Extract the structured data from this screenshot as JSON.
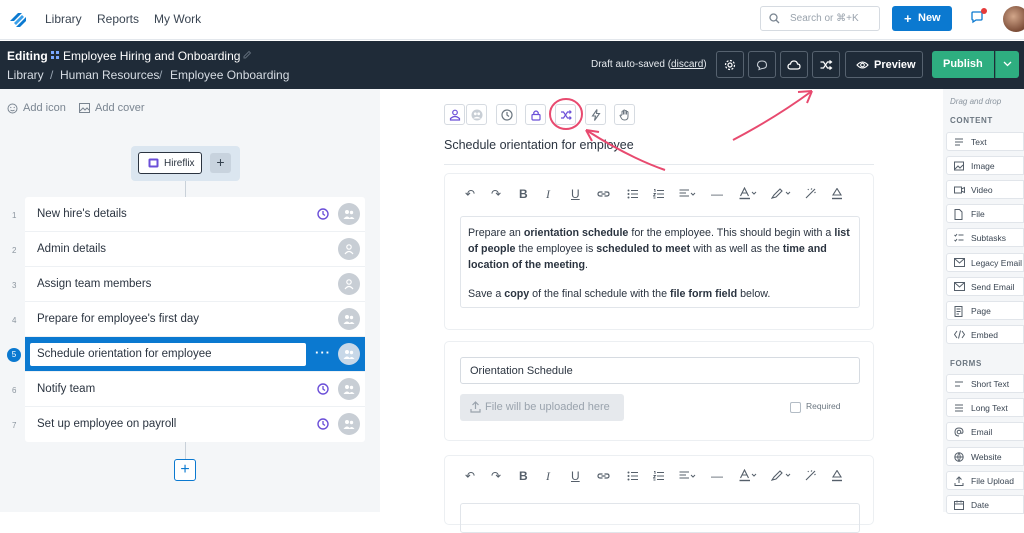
{
  "topnav": {
    "links": [
      "Library",
      "Reports",
      "My Work"
    ],
    "search_placeholder": "Search or ⌘+K",
    "new_label": "New"
  },
  "header": {
    "editing_label": "Editing",
    "workflow_title": "Employee Hiring and Onboarding",
    "breadcrumb": [
      "Library",
      "Human Resources",
      "Employee Onboarding"
    ],
    "autosave_text": "Draft auto-saved (",
    "discard_label": "discard",
    "autosave_close": ")",
    "preview_label": "Preview",
    "publish_label": "Publish"
  },
  "left": {
    "add_icon_label": "Add icon",
    "add_cover_label": "Add cover",
    "trigger_label": "Hireflix",
    "tasks": [
      {
        "num": "1",
        "title": "New hire's details"
      },
      {
        "num": "2",
        "title": "Admin details"
      },
      {
        "num": "3",
        "title": "Assign team members"
      },
      {
        "num": "4",
        "title": "Prepare for employee's first day"
      },
      {
        "num": "5",
        "title": "Schedule orientation for employee"
      },
      {
        "num": "6",
        "title": "Notify team"
      },
      {
        "num": "7",
        "title": "Set up employee on payroll"
      }
    ],
    "active_dots": "···"
  },
  "editor": {
    "task_heading": "Schedule orientation for employee",
    "text_block": {
      "p1_parts": [
        "Prepare an ",
        "orientation schedule",
        " for the employee. This should begin with a ",
        "list of people",
        " the employee is ",
        "scheduled to meet",
        " with as well as the ",
        "time and location of the meeting",
        "."
      ],
      "p2_parts": [
        "Save a ",
        "copy",
        " of the final schedule with the ",
        "file form field",
        " below."
      ]
    },
    "file_field": {
      "value": "Orientation Schedule",
      "upload_label": "File will be uploaded here",
      "required_label": "Required"
    }
  },
  "palette": {
    "hint": "Drag and drop",
    "content_header": "CONTENT",
    "content_items": [
      "Text",
      "Image",
      "Video",
      "File",
      "Subtasks",
      "Legacy Email",
      "Send Email",
      "Page",
      "Embed"
    ],
    "forms_header": "FORMS",
    "form_items": [
      "Short Text",
      "Long Text",
      "Email",
      "Website",
      "File Upload",
      "Date"
    ]
  },
  "colors": {
    "primary": "#0b79d0",
    "publish": "#2eae80",
    "dark_header": "#1f2b38",
    "annotation": "#e84a6f",
    "purple_icon": "#6b4fd8"
  }
}
